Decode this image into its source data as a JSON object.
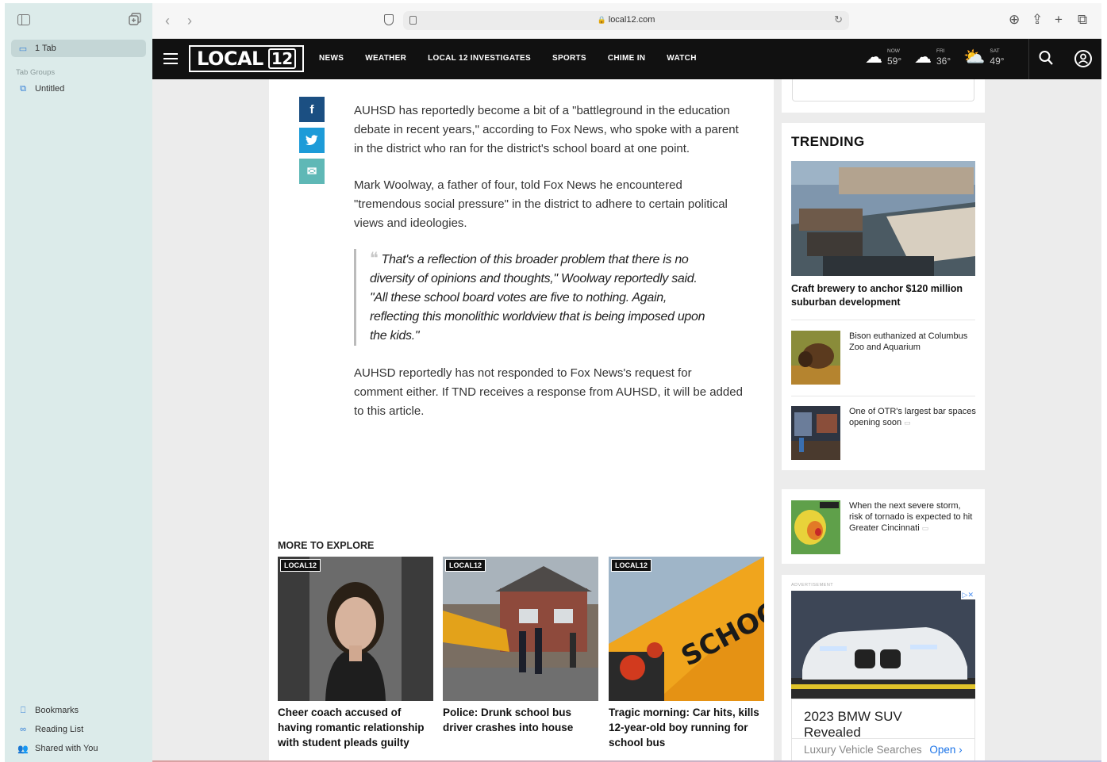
{
  "browser": {
    "url": "local12.com",
    "sidebar": {
      "tab_count_label": "1 Tab",
      "tab_groups_label": "Tab Groups",
      "group_item": "Untitled",
      "bookmarks_label": "Bookmarks",
      "reading_list_label": "Reading List",
      "shared_label": "Shared with You"
    }
  },
  "site": {
    "logo_text": "LOCAL",
    "logo_num": "12",
    "nav": [
      "NEWS",
      "WEATHER",
      "LOCAL 12 INVESTIGATES",
      "SPORTS",
      "CHIME IN",
      "WATCH"
    ],
    "weather": [
      {
        "label": "NOW",
        "temp": "59°",
        "icon": "cloud-icon"
      },
      {
        "label": "FRI",
        "temp": "36°",
        "icon": "rain-cloud-icon"
      },
      {
        "label": "SAT",
        "temp": "49°",
        "icon": "partly-sunny-icon"
      }
    ]
  },
  "article": {
    "paragraphs": [
      "AUHSD has reportedly become a bit of a \"battleground in the education debate in recent years,\" according to Fox News, who spoke with a parent in the district who ran for the district's school board at one point.",
      "Mark Woolway, a father of four, told Fox News he encountered \"tremendous social pressure\" in the district to adhere to certain political views and ideologies.",
      "AUHSD reportedly has not responded to Fox News's request for comment either. If TND receives a response from AUHSD, it will be added to this article."
    ],
    "quote": "That's a reflection of this broader problem that there is no diversity of opinions and thoughts,\" Woolway reportedly said. \"All these school board votes are five to nothing. Again, reflecting this monolithic worldview that is being imposed upon the kids.\""
  },
  "explore": {
    "title": "MORE TO EXPLORE",
    "badge": "LOCAL12",
    "cards": [
      {
        "title": "Cheer coach accused of having romantic relationship with student pleads guilty"
      },
      {
        "title": "Police: Drunk school bus driver crashes into house"
      },
      {
        "title": "Tragic morning: Car hits, kills 12-year-old boy running for school bus"
      }
    ]
  },
  "trending": {
    "title": "TRENDING",
    "lead": "Craft brewery to anchor $120 million suburban development",
    "items": [
      {
        "title": "Bison euthanized at Columbus Zoo and Aquarium"
      },
      {
        "title": "One of OTR's largest bar spaces opening soon"
      },
      {
        "title": "When the next severe storm, risk of tornado is expected to hit Greater Cincinnati"
      }
    ]
  },
  "ad": {
    "label": "ADVERTISEMENT",
    "headline": "2023 BMW SUV Revealed",
    "source": "Luxury Vehicle Searches",
    "cta": "Open"
  }
}
